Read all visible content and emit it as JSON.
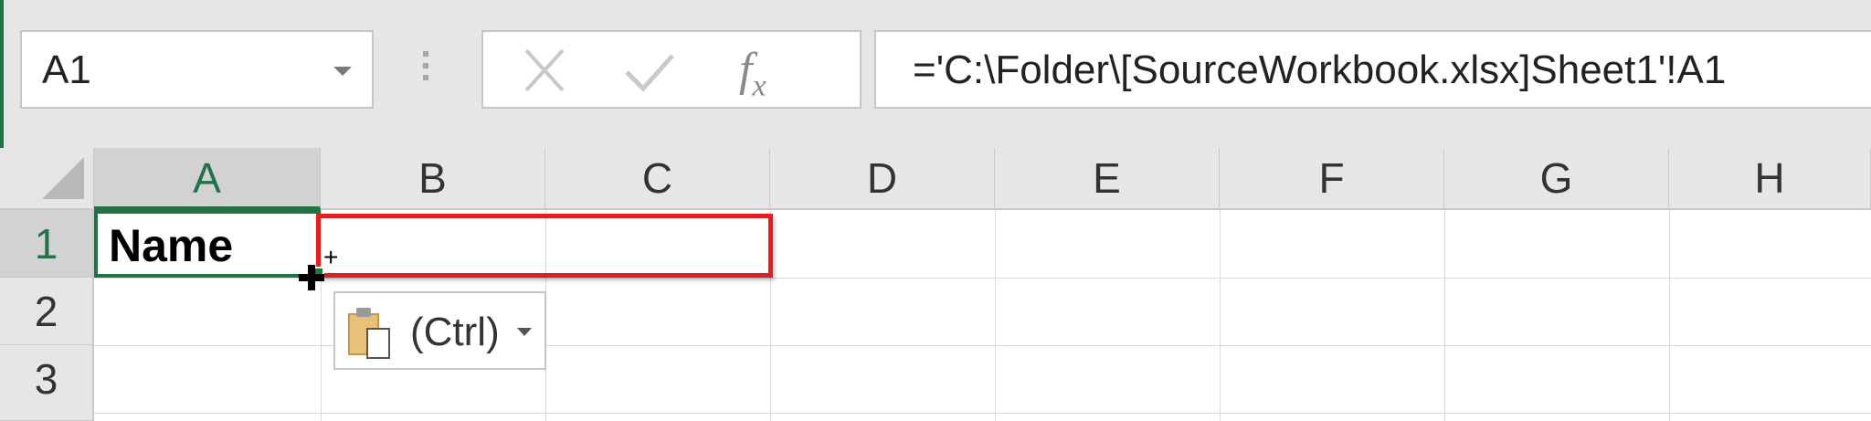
{
  "formula_bar": {
    "name_box": "A1",
    "cancel_icon": "✕",
    "enter_icon": "✓",
    "function_label": "f",
    "function_sub": "x",
    "formula": "='C:\\Folder\\[SourceWorkbook.xlsx]Sheet1'!A1"
  },
  "grid": {
    "columns": [
      "A",
      "B",
      "C",
      "D",
      "E",
      "F",
      "G",
      "H"
    ],
    "rows": [
      "1",
      "2",
      "3"
    ],
    "cells": {
      "A1": "Name"
    },
    "selected_cell": "A1"
  },
  "paste_options": {
    "label": "(Ctrl)"
  },
  "colors": {
    "selection": "#217346",
    "highlight": "#e02020"
  }
}
